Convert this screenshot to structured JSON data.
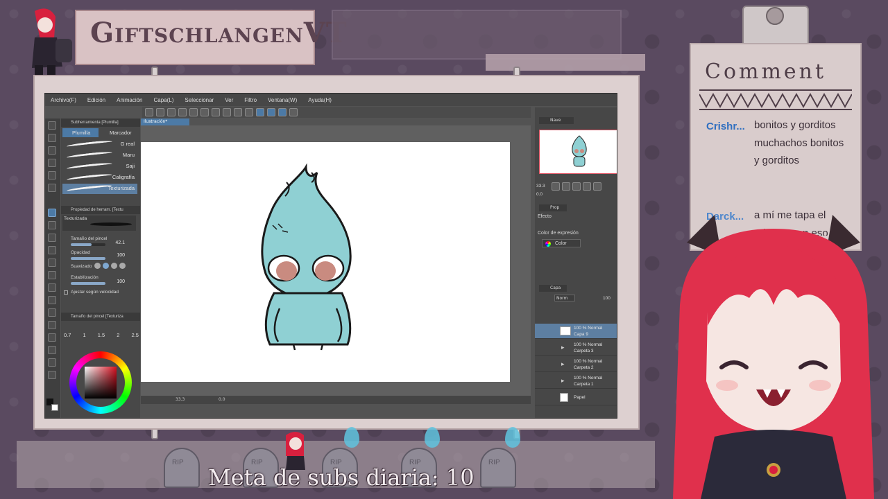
{
  "header": {
    "channel_name": "GiftschlangenVT"
  },
  "app": {
    "menu": [
      "Archivo(F)",
      "Edición",
      "Animación",
      "Capa(L)",
      "Seleccionar",
      "Ver",
      "Filtro",
      "Ventana(W)",
      "Ayuda(H)"
    ],
    "canvas_tab": "Ilustración*",
    "subtool": {
      "header": "Subherramienta [Plumilla]",
      "tabs": [
        "Plumilla",
        "Marcador"
      ],
      "brushes": [
        "G real",
        "Maru",
        "Saji",
        "Caligrafía",
        "Texturizada"
      ]
    },
    "tool_property": {
      "header": "Propiedad de herram. [Textu",
      "brush_name": "Texturizada",
      "size_label": "Tamaño del pincel",
      "size_value": "42.1",
      "opacity_label": "Opacidad",
      "opacity_value": "100",
      "smoothing_label": "Suavizado",
      "stabilization_label": "Estabilización",
      "stabilization_value": "100",
      "speed_label": "Ajustar según velocidad"
    },
    "brush_size": {
      "header": "Tamaño del pincel [Texturiza",
      "sizes": [
        "0.7",
        "1",
        "1.5",
        "2",
        "2.5"
      ]
    },
    "status": {
      "zoom": "33.3",
      "angle": "0.0"
    },
    "navigator": {
      "tab": "Nave",
      "zoom": "33.3",
      "angle": "0.0"
    },
    "property": {
      "tab": "Prop",
      "section": "Efecto",
      "expression_label": "Color de expresión",
      "expression_value": "Color"
    },
    "layers": {
      "tab": "Capa",
      "blend_mode": "Norm",
      "opacity": "100",
      "items": [
        {
          "line1": "100 % Normal",
          "line2": "Capa 9"
        },
        {
          "line1": "100 % Normal",
          "line2": "Carpeta 3"
        },
        {
          "line1": "100 % Normal",
          "line2": "Carpeta 2"
        },
        {
          "line1": "100 % Normal",
          "line2": "Carpeta 1"
        },
        {
          "line1": "",
          "line2": "Papel"
        }
      ]
    }
  },
  "chat": {
    "title": "Comment",
    "messages": [
      {
        "user": "Crishr...",
        "text": "bonitos y gorditos muchachos bonitos y gorditos",
        "color": "#2f6fc0"
      },
      {
        "user": "Darck...",
        "text": "a mí me tapa el relamo, con eso",
        "color": "#4d86cc"
      }
    ]
  },
  "bottom": {
    "goal_text": "Meta de subs diaria: 10",
    "grave_label": "RIP"
  },
  "colors": {
    "ghost_body": "#8fd0d3",
    "ghost_eye": "#c98b80",
    "accent_blue": "#4c7aa6",
    "hair_red": "#e0304c"
  }
}
